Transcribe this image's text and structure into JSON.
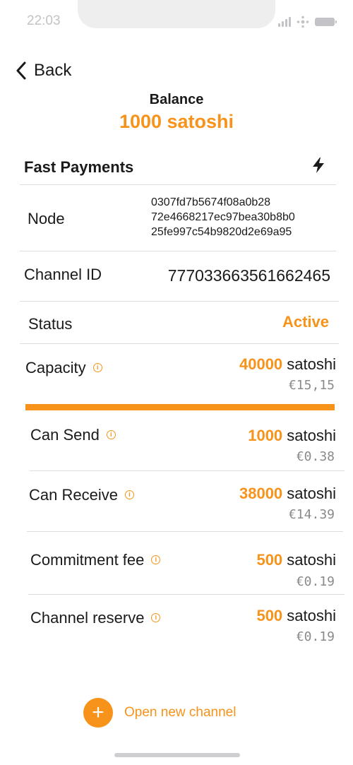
{
  "status_bar": {
    "time": "22:03"
  },
  "nav": {
    "back_label": "Back"
  },
  "balance": {
    "label": "Balance",
    "value": "1000 satoshi"
  },
  "fast_payments": {
    "title": "Fast Payments",
    "icon": "lightning-icon"
  },
  "node": {
    "label": "Node",
    "id_lines": [
      "0307fd7b5674f08a0b28",
      "72e4668217ec97bea30b8b0",
      "25fe997c54b9820d2e69a95"
    ]
  },
  "channel": {
    "label": "Channel ID",
    "value": "777033663561662465"
  },
  "status": {
    "label": "Status",
    "value": "Active"
  },
  "capacity": {
    "label": "Capacity",
    "amount": "40000",
    "unit": " satoshi",
    "fiat": "€15,15",
    "fill_fraction": 1.0
  },
  "can_send": {
    "label": "Can Send",
    "amount": "1000",
    "unit": " satoshi",
    "fiat": "€0.38"
  },
  "can_receive": {
    "label": "Can Receive",
    "amount": "38000",
    "unit": " satoshi",
    "fiat": "€14.39"
  },
  "commitment_fee": {
    "label": "Commitment fee",
    "amount": "500",
    "unit": " satoshi",
    "fiat": "€0.19"
  },
  "channel_reserve": {
    "label": "Channel reserve",
    "amount": "500",
    "unit": " satoshi",
    "fiat": "€0.19"
  },
  "actions": {
    "open_channel_label": "Open new channel",
    "plus": "+"
  },
  "colors": {
    "accent": "#f7931a",
    "text": "#1a1a1a",
    "muted": "#8a8a8a",
    "divider": "#dddddd"
  }
}
